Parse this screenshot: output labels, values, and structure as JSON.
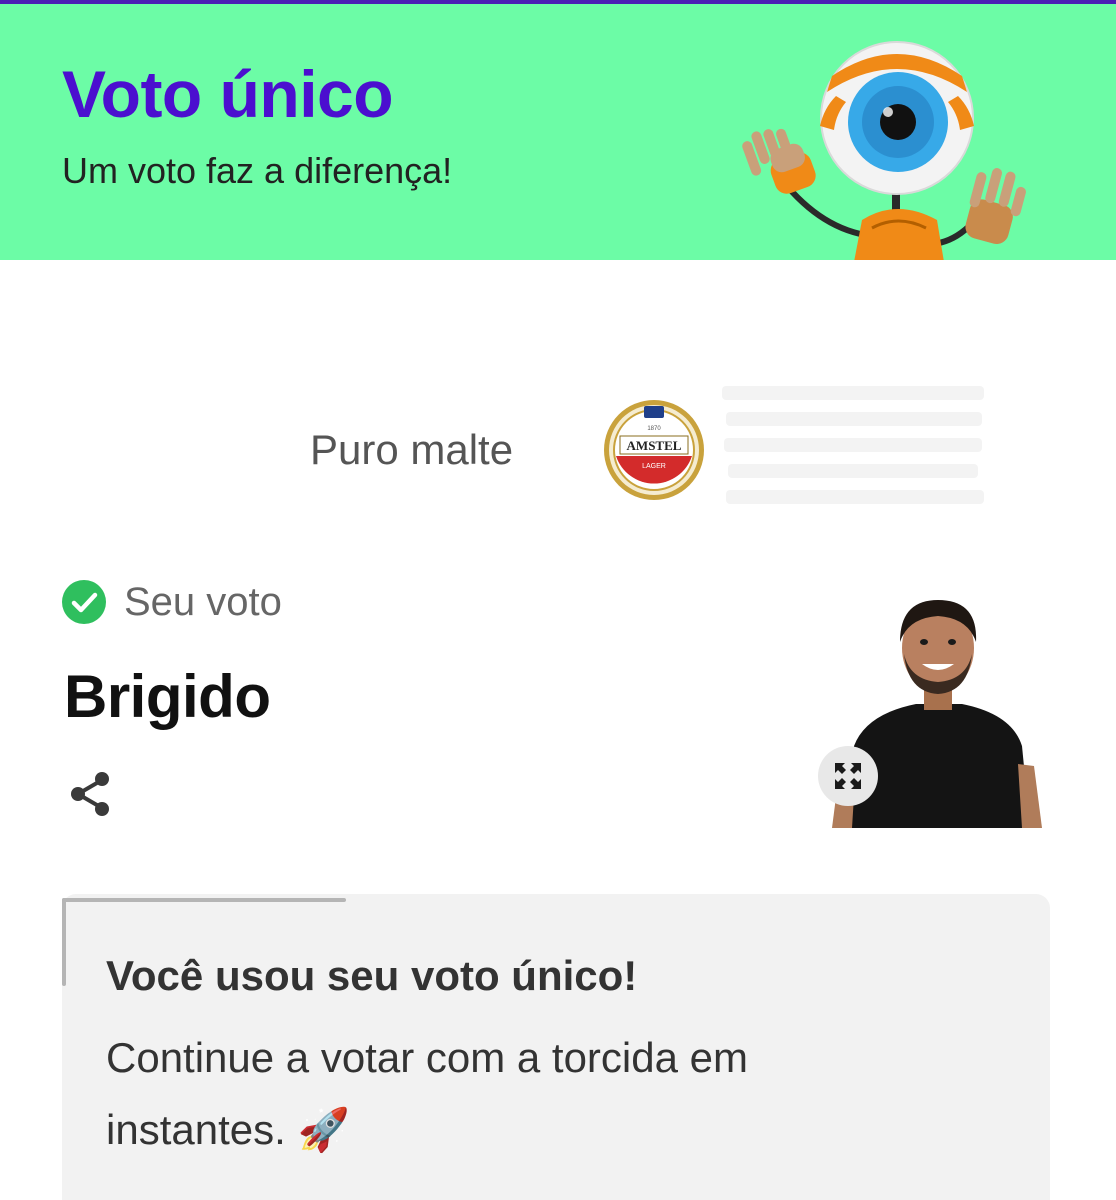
{
  "hero": {
    "title": "Voto único",
    "subtitle": "Um voto faz a diferença!",
    "mascot_icon": "big-brother-eye-mascot"
  },
  "sponsor": {
    "text": "Puro malte",
    "logo_text": "AMSTEL",
    "logo_subtext": "LAGER",
    "logo_year": "1870"
  },
  "vote": {
    "label": "Seu voto",
    "candidate": "Brigido",
    "status_icon": "check-circle-icon",
    "share_icon": "share-icon",
    "expand_icon": "expand-icon"
  },
  "notice": {
    "title": "Você usou seu voto único!",
    "body": "Continue a votar com a torcida em instantes. 🚀"
  },
  "colors": {
    "brand_purple": "#4b0fcf",
    "hero_green": "#6cfca6",
    "check_green": "#2fbf5e",
    "notice_bg": "#f2f2f2"
  }
}
